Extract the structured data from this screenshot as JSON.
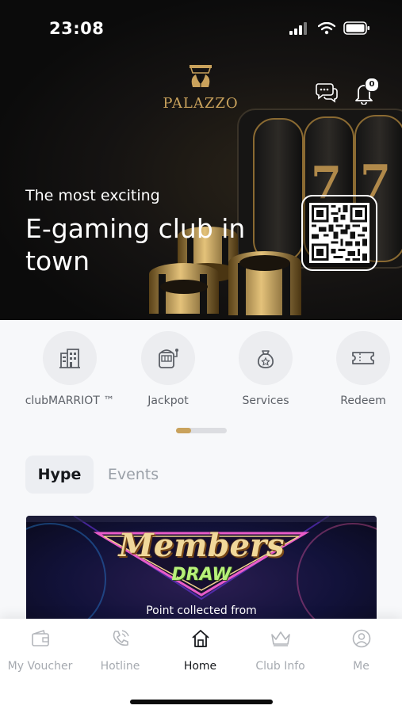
{
  "status_bar": {
    "time": "23:08"
  },
  "brand": {
    "logo_text": "PALAZZO"
  },
  "header": {
    "notification_count": "0"
  },
  "hero": {
    "subtitle": "The most exciting",
    "title": "E-gaming club in town"
  },
  "quick_actions": [
    {
      "label": "clubMARRIOT ™",
      "icon": "building-icon"
    },
    {
      "label": "Jackpot",
      "icon": "slot-machine-icon"
    },
    {
      "label": "Services",
      "icon": "bag-icon"
    },
    {
      "label": "Redeem",
      "icon": "ticket-icon"
    }
  ],
  "pager": {
    "progress": 0.3
  },
  "tabs": [
    {
      "label": "Hype",
      "active": true
    },
    {
      "label": "Events",
      "active": false
    }
  ],
  "banner": {
    "headline": "Members",
    "subheadline": "DRAW",
    "caption": "Point collected from"
  },
  "bottom_nav": [
    {
      "label": "My Voucher",
      "icon": "wallet-icon",
      "active": false
    },
    {
      "label": "Hotline",
      "icon": "phone-icon",
      "active": false
    },
    {
      "label": "Home",
      "icon": "home-icon",
      "active": true
    },
    {
      "label": "Club Info",
      "icon": "crown-icon",
      "active": false
    },
    {
      "label": "Me",
      "icon": "user-icon",
      "active": false
    }
  ],
  "colors": {
    "accent_gold": "#c9a25c",
    "background": "#f7f8fa",
    "inactive_text": "#a6aab0",
    "active_text": "#16181c"
  }
}
